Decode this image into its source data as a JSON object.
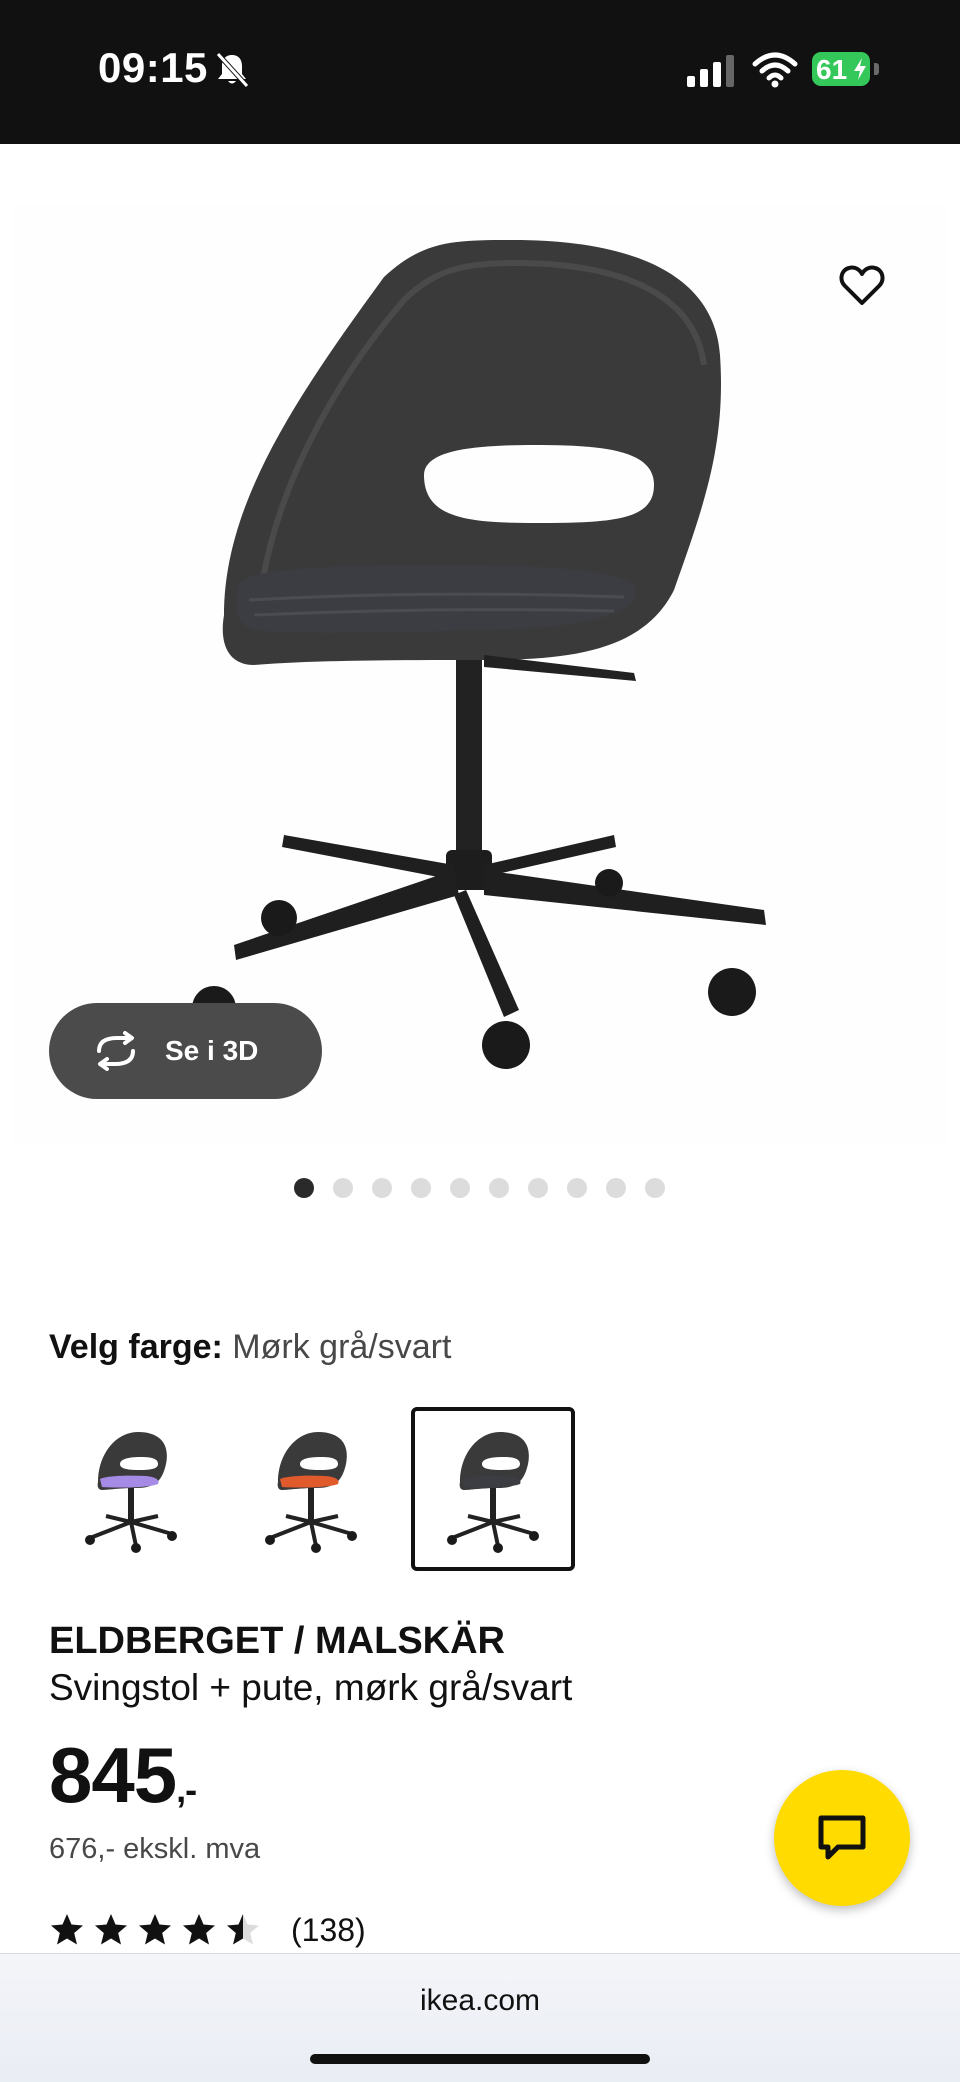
{
  "status_bar": {
    "time": "09:15",
    "battery": "61",
    "icons": [
      "bell-slash-icon",
      "cellular-signal-icon",
      "wifi-icon",
      "battery-charging-icon"
    ]
  },
  "gallery": {
    "view_3d_label": "Se i 3D",
    "image_count": 10,
    "active_index": 0,
    "icons": [
      "heart-icon",
      "rotate-3d-icon"
    ]
  },
  "color_picker": {
    "label": "Velg farge:",
    "selected_value": "Mørk grå/svart",
    "options": [
      {
        "name": "lilla",
        "cushion_color": "#a58be6",
        "selected": false
      },
      {
        "name": "oransje",
        "cushion_color": "#e05a2b",
        "selected": false
      },
      {
        "name": "mørk grå",
        "cushion_color": "#3b3d42",
        "selected": true
      }
    ]
  },
  "product": {
    "brand": "ELDBERGET / MALSKÄR",
    "description": "Svingstol + pute, mørk grå/svart",
    "price": "845",
    "price_suffix": ",-",
    "price_ex_vat": "676,- ekskl. mva",
    "rating_value": 4.5,
    "rating_max": 5,
    "review_count": "(138)"
  },
  "chat": {
    "icon": "chat-bubble-icon"
  },
  "browser": {
    "url": "ikea.com"
  },
  "colors": {
    "ikea_yellow": "#ffdb00",
    "chair_shell": "#3a3a3a",
    "cushion": "#3b3d42",
    "pill": "#4b4b4b"
  }
}
